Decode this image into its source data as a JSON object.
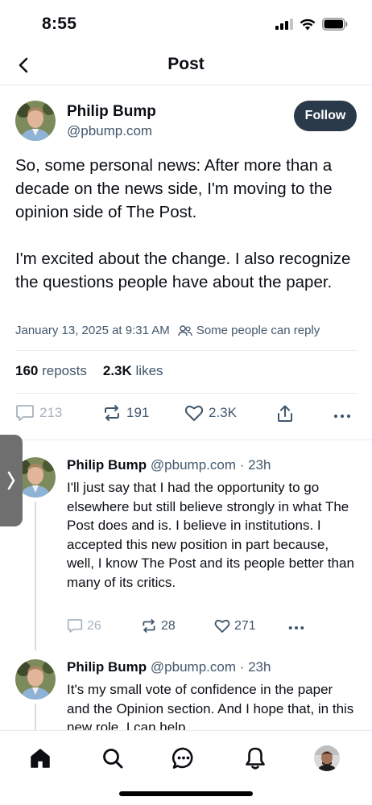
{
  "status_bar": {
    "time": "8:55"
  },
  "header": {
    "title": "Post"
  },
  "post": {
    "author_name": "Philip Bump",
    "author_handle": "@pbump.com",
    "follow_label": "Follow",
    "text": "So, some personal news: After more than a decade on the news side, I'm moving to the opinion side of The Post.\n\nI'm excited about the change. I also recognize the questions people have about the paper.",
    "timestamp": "January 13, 2025 at 9:31 AM",
    "reply_setting": "Some people can reply",
    "reposts_count": "160",
    "reposts_label": "reposts",
    "likes_count": "2.3K",
    "likes_label": "likes",
    "actions": {
      "replies": "213",
      "reposts": "191",
      "likes": "2.3K"
    }
  },
  "replies": [
    {
      "author_name": "Philip Bump",
      "author_handle": "@pbump.com",
      "age": "· 23h",
      "text": "I'll just say that I had the opportunity to go elsewhere but still believe strongly in what The Post does and is. I believe in institutions. I accepted this new position in part because, well, I know The Post and its people better than many of its critics.",
      "replies": "26",
      "reposts": "28",
      "likes": "271"
    },
    {
      "author_name": "Philip Bump",
      "author_handle": "@pbump.com",
      "age": "· 23h",
      "text": "It's my small vote of confidence in the paper and the Opinion section. And I hope that, in this new role, I can help"
    }
  ],
  "icons": {
    "back": "chevron-left-icon",
    "reply": "speech-bubble-icon",
    "repost": "repost-arrows-icon",
    "like": "heart-icon",
    "share": "share-icon",
    "more": "ellipsis-icon",
    "home": "home-icon",
    "search": "search-icon",
    "chat": "chat-icon",
    "notifications": "bell-icon"
  },
  "colors": {
    "follow_bg": "#2b3a4a",
    "muted_text": "#42576c",
    "disabled": "#a6b3bf"
  }
}
